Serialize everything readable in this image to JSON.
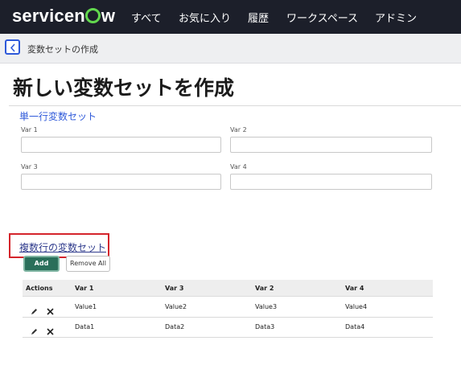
{
  "header": {
    "logo_text": "servicenow",
    "nav": [
      "すべて",
      "お気に入り",
      "履歴",
      "ワークスペース",
      "アドミン"
    ]
  },
  "breadcrumb": {
    "text": "変数セットの作成"
  },
  "page_title": "新しい変数セットを作成",
  "single_row_set": {
    "title": "単一行変数セット",
    "fields": [
      {
        "label": "Var 1",
        "value": ""
      },
      {
        "label": "Var 2",
        "value": ""
      },
      {
        "label": "Var 3",
        "value": ""
      },
      {
        "label": "Var 4",
        "value": ""
      }
    ]
  },
  "multi_row_set": {
    "title": "複数行の変数セット",
    "add_label": "Add",
    "remove_all_label": "Remove All",
    "columns": [
      "Actions",
      "Var 1",
      "Var 3",
      "Var 2",
      "Var 4"
    ],
    "rows": [
      [
        "Value1",
        "Value2",
        "Value3",
        "Value4"
      ],
      [
        "Data1",
        "Data2",
        "Data3",
        "Data4"
      ]
    ]
  },
  "colors": {
    "nav_bg": "#1c1f2a",
    "logo_accent": "#62d84e",
    "link_blue": "#2e59d9",
    "highlight_red": "#d4242b",
    "add_button": "#2a6f5a"
  },
  "icons": {
    "back": "chevron-left-icon",
    "edit": "pencil-icon",
    "delete": "close-icon"
  }
}
